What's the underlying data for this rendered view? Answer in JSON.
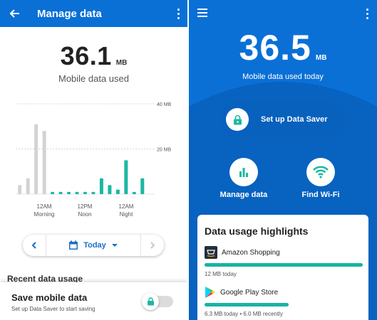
{
  "left": {
    "title": "Manage data",
    "usage_value": "36.1",
    "usage_unit": "MB",
    "usage_label": "Mobile data used",
    "date_selector": {
      "value": "Today"
    },
    "recent_heading": "Recent data usage",
    "save_card": {
      "title": "Save mobile data",
      "subtitle": "Set up Data Saver to start saving"
    }
  },
  "chart_data": {
    "type": "bar",
    "y_unit": "MB",
    "ylim": [
      0,
      40
    ],
    "y_tick_labels": [
      "40 MB",
      "20 MB"
    ],
    "x_tick_labels": [
      {
        "time": "12AM",
        "period": "Morning"
      },
      {
        "time": "12PM",
        "period": "Noon"
      },
      {
        "time": "12AM",
        "period": "Night"
      }
    ],
    "series": [
      {
        "label_color": "#d3d3d3",
        "values": [
          4,
          7,
          31,
          28,
          0,
          0,
          0,
          0,
          0,
          0,
          0,
          0,
          0,
          0,
          0,
          0,
          0
        ]
      },
      {
        "label_color": "#1cb8a3",
        "values": [
          0,
          0,
          0,
          0,
          1,
          1,
          1,
          1,
          1,
          1,
          7,
          4,
          2,
          15,
          1,
          7,
          0
        ]
      }
    ]
  },
  "right": {
    "usage_value": "36.5",
    "usage_unit": "MB",
    "usage_label": "Mobile data used today",
    "saver_button": "Set up Data Saver",
    "actions": [
      {
        "label": "Manage data",
        "icon": "bar-chart-icon"
      },
      {
        "label": "Find Wi-Fi",
        "icon": "wifi-icon"
      }
    ],
    "highlights": {
      "title": "Data usage highlights",
      "apps": [
        {
          "name": "Amazon Shopping",
          "detail": "12 MB today",
          "fraction": 1.0
        },
        {
          "name": "Google Play Store",
          "detail": "6.3 MB today  •  6.0 MB recently",
          "fraction": 0.53
        }
      ]
    }
  },
  "colors": {
    "blue": "#0a70d6",
    "teal": "#1cb8a3",
    "gray_bar": "#d3d3d3"
  }
}
